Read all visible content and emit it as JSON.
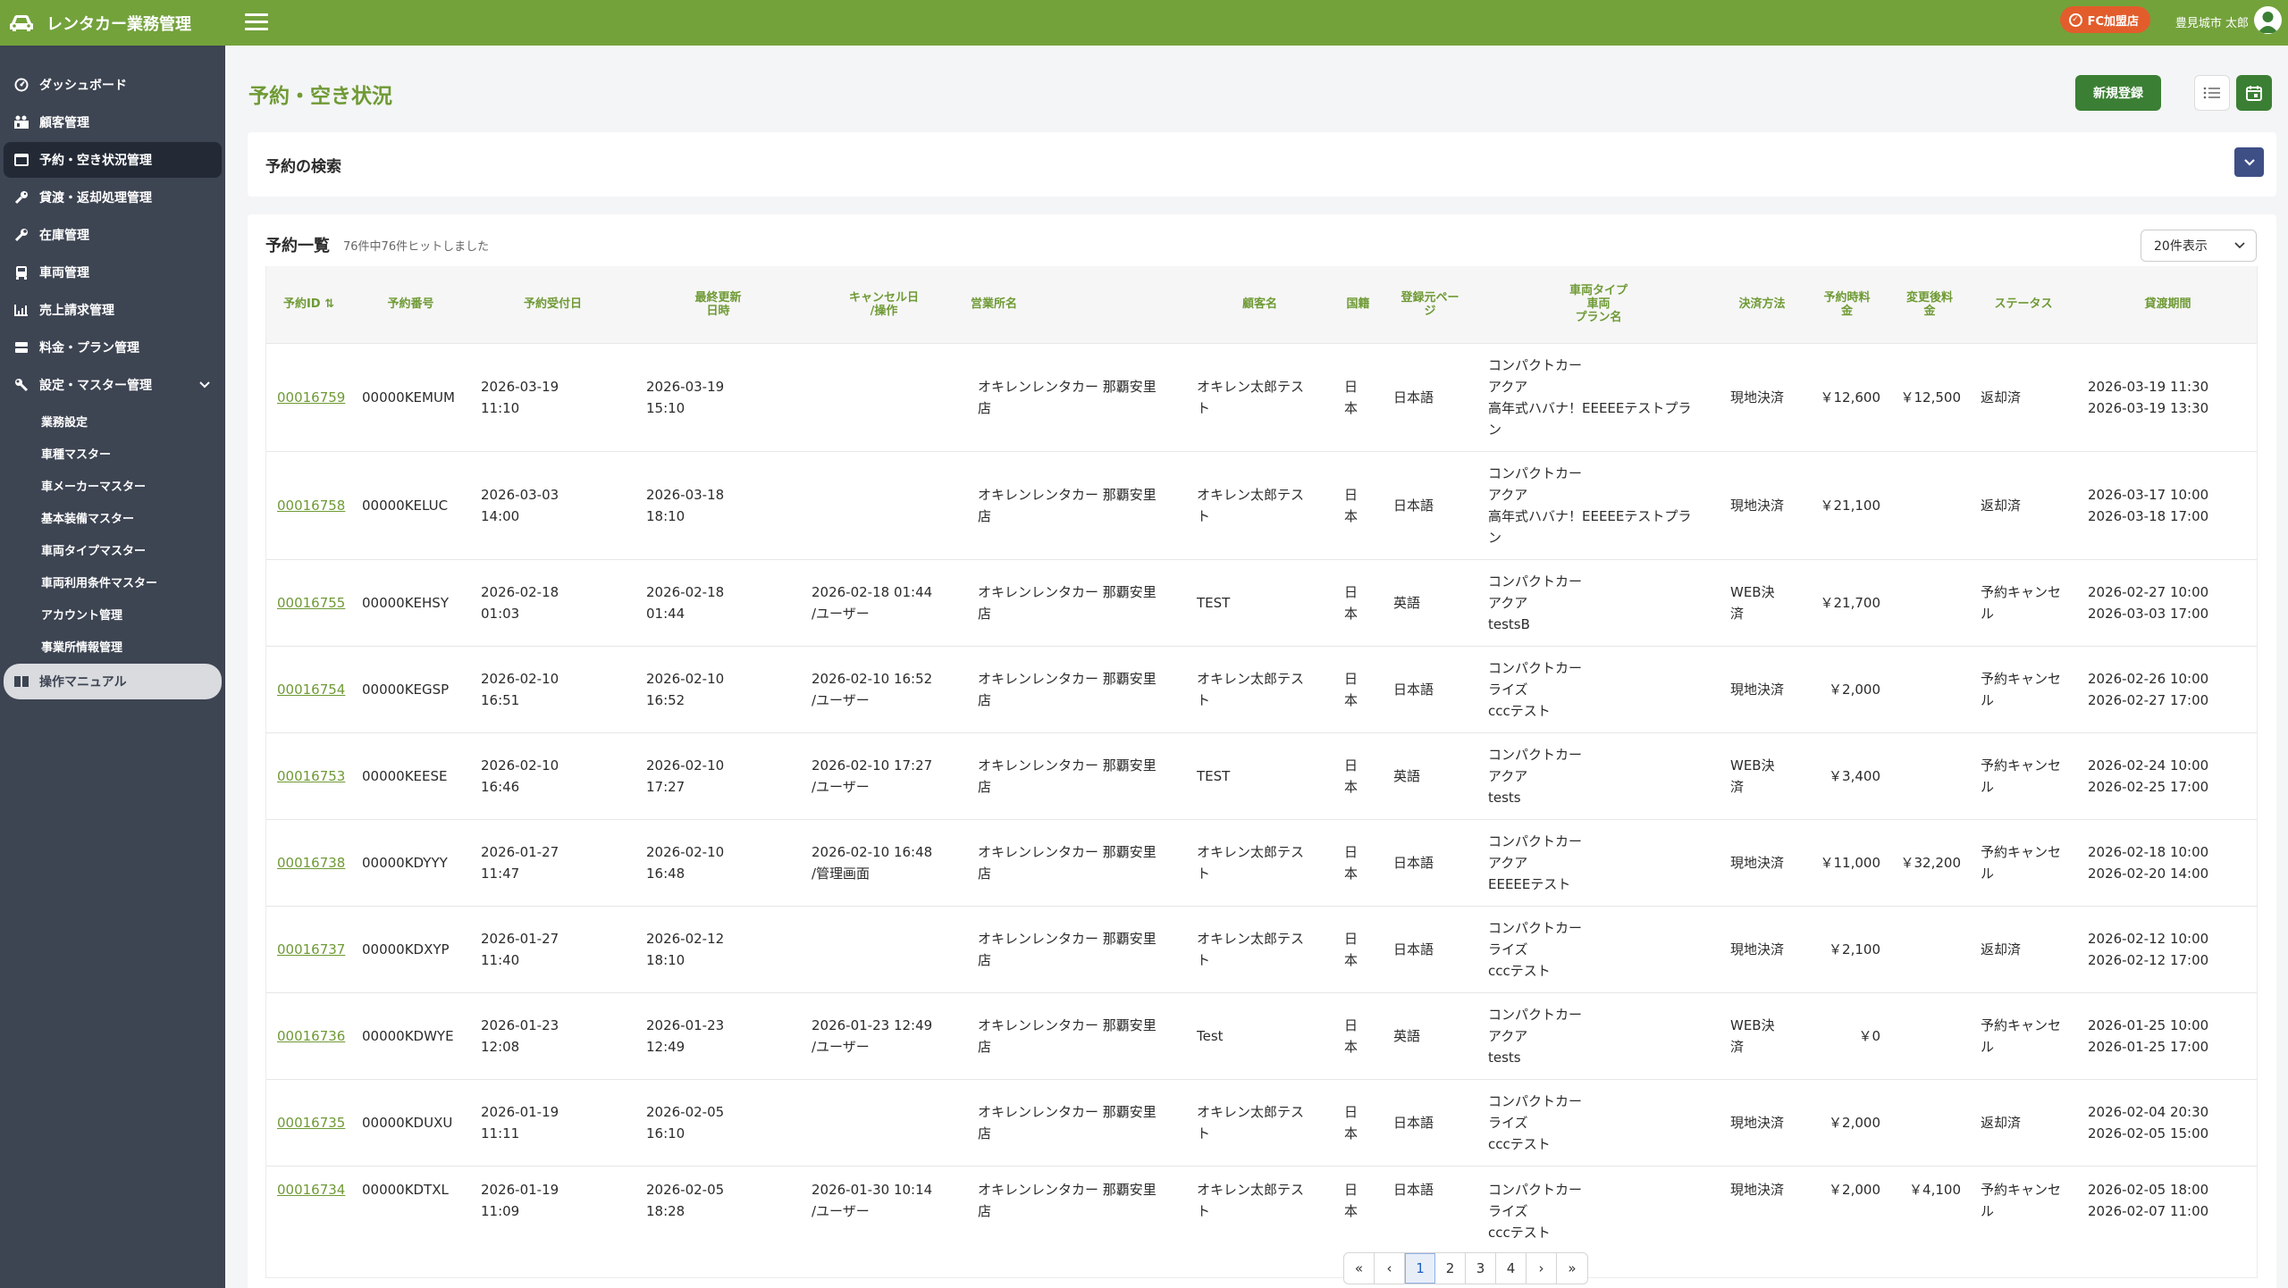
{
  "app": {
    "title": "レンタカー業務管理"
  },
  "topbar": {
    "fc_badge": "FC加盟店",
    "user_name": "豊見城市 太郎"
  },
  "sidebar": {
    "items": [
      {
        "label": "ダッシュボード",
        "icon": "dashboard-icon"
      },
      {
        "label": "顧客管理",
        "icon": "customers-icon"
      },
      {
        "label": "予約・空き状況管理",
        "icon": "calendar-icon"
      },
      {
        "label": "貸渡・返却処理管理",
        "icon": "key-icon"
      },
      {
        "label": "在庫管理",
        "icon": "wrench-icon"
      },
      {
        "label": "車両管理",
        "icon": "car-icon"
      },
      {
        "label": "売上請求管理",
        "icon": "sales-chart-icon"
      },
      {
        "label": "料金・プラン管理",
        "icon": "price-icon"
      },
      {
        "label": "設定・マスター管理",
        "icon": "settings-icon"
      }
    ],
    "sub_items": [
      "業務設定",
      "車種マスター",
      "車メーカーマスター",
      "基本装備マスター",
      "車両タイプマスター",
      "車両利用条件マスター",
      "アカウント管理",
      "事業所情報管理"
    ],
    "manual": {
      "label": "操作マニュアル",
      "icon": "book-icon"
    }
  },
  "page": {
    "title": "予約・空き状況",
    "new_button": "新規登録"
  },
  "search": {
    "title": "予約の検索"
  },
  "list": {
    "title": "予約一覧",
    "hit_count": "76件中76件ヒットしました",
    "page_size": "20件表示"
  },
  "table": {
    "headers": {
      "id": "予約ID ⇅",
      "num": "予約番号",
      "received": "予約受付日",
      "updated": "最終更新\n日時",
      "cancel": "キャンセル日\n/操作",
      "office": "営業所名",
      "customer": "顧客名",
      "nation": "国籍",
      "source": "登録元ペー\nジ",
      "vehicle": "車両タイプ\n車両\nプラン名",
      "payment": "決済方法",
      "fee": "予約時料\n金",
      "fee_changed": "変更後料\n金",
      "status": "ステータス",
      "period": "貸渡期間"
    },
    "rows": [
      {
        "id": "00016759",
        "num": "00000KEMUM",
        "received": "2026-03-19\n11:10",
        "updated": "2026-03-19\n15:10",
        "cancel": "",
        "office": "オキレンレンタカー 那覇安里\n店",
        "customer": "オキレン太郎テス\nト",
        "nation": "日\n本",
        "source": "日本語",
        "vehicle": "コンパクトカー\nアクア\n高年式ハバナ！EEEEEテストプラ\nン",
        "payment": "現地決済",
        "fee": "￥12,600",
        "fee_changed": "￥12,500",
        "status": "返却済",
        "period": "2026-03-19 11:30\n2026-03-19 13:30"
      },
      {
        "id": "00016758",
        "num": "00000KELUC",
        "received": "2026-03-03\n14:00",
        "updated": "2026-03-18\n18:10",
        "cancel": "",
        "office": "オキレンレンタカー 那覇安里\n店",
        "customer": "オキレン太郎テス\nト",
        "nation": "日\n本",
        "source": "日本語",
        "vehicle": "コンパクトカー\nアクア\n高年式ハバナ！EEEEEテストプラ\nン",
        "payment": "現地決済",
        "fee": "￥21,100",
        "fee_changed": "",
        "status": "返却済",
        "period": "2026-03-17 10:00\n2026-03-18 17:00"
      },
      {
        "id": "00016755",
        "num": "00000KEHSY",
        "received": "2026-02-18\n01:03",
        "updated": "2026-02-18\n01:44",
        "cancel": "2026-02-18 01:44\n/ユーザー",
        "office": "オキレンレンタカー 那覇安里\n店",
        "customer": "TEST",
        "nation": "日\n本",
        "source": "英語",
        "vehicle": "コンパクトカー\nアクア\ntestsB",
        "payment": "WEB決\n済",
        "fee": "￥21,700",
        "fee_changed": "",
        "status": "予約キャンセ\nル",
        "period": "2026-02-27 10:00\n2026-03-03 17:00"
      },
      {
        "id": "00016754",
        "num": "00000KEGSP",
        "received": "2026-02-10\n16:51",
        "updated": "2026-02-10\n16:52",
        "cancel": "2026-02-10 16:52\n/ユーザー",
        "office": "オキレンレンタカー 那覇安里\n店",
        "customer": "オキレン太郎テス\nト",
        "nation": "日\n本",
        "source": "日本語",
        "vehicle": "コンパクトカー\nライズ\ncccテスト",
        "payment": "現地決済",
        "fee": "￥2,000",
        "fee_changed": "",
        "status": "予約キャンセ\nル",
        "period": "2026-02-26 10:00\n2026-02-27 17:00"
      },
      {
        "id": "00016753",
        "num": "00000KEESE",
        "received": "2026-02-10\n16:46",
        "updated": "2026-02-10\n17:27",
        "cancel": "2026-02-10 17:27\n/ユーザー",
        "office": "オキレンレンタカー 那覇安里\n店",
        "customer": "TEST",
        "nation": "日\n本",
        "source": "英語",
        "vehicle": "コンパクトカー\nアクア\ntests",
        "payment": "WEB決\n済",
        "fee": "￥3,400",
        "fee_changed": "",
        "status": "予約キャンセ\nル",
        "period": "2026-02-24 10:00\n2026-02-25 17:00"
      },
      {
        "id": "00016738",
        "num": "00000KDYYY",
        "received": "2026-01-27\n11:47",
        "updated": "2026-02-10\n16:48",
        "cancel": "2026-02-10 16:48\n/管理画面",
        "office": "オキレンレンタカー 那覇安里\n店",
        "customer": "オキレン太郎テス\nト",
        "nation": "日\n本",
        "source": "日本語",
        "vehicle": "コンパクトカー\nアクア\nEEEEEテスト",
        "payment": "現地決済",
        "fee": "￥11,000",
        "fee_changed": "￥32,200",
        "status": "予約キャンセ\nル",
        "period": "2026-02-18 10:00\n2026-02-20 14:00"
      },
      {
        "id": "00016737",
        "num": "00000KDXYP",
        "received": "2026-01-27\n11:40",
        "updated": "2026-02-12\n18:10",
        "cancel": "",
        "office": "オキレンレンタカー 那覇安里\n店",
        "customer": "オキレン太郎テス\nト",
        "nation": "日\n本",
        "source": "日本語",
        "vehicle": "コンパクトカー\nライズ\ncccテスト",
        "payment": "現地決済",
        "fee": "￥2,100",
        "fee_changed": "",
        "status": "返却済",
        "period": "2026-02-12 10:00\n2026-02-12 17:00"
      },
      {
        "id": "00016736",
        "num": "00000KDWYE",
        "received": "2026-01-23\n12:08",
        "updated": "2026-01-23\n12:49",
        "cancel": "2026-01-23 12:49\n/ユーザー",
        "office": "オキレンレンタカー 那覇安里\n店",
        "customer": "Test",
        "nation": "日\n本",
        "source": "英語",
        "vehicle": "コンパクトカー\nアクア\ntests",
        "payment": "WEB決\n済",
        "fee": "￥0",
        "fee_changed": "",
        "status": "予約キャンセ\nル",
        "period": "2026-01-25 10:00\n2026-01-25 17:00"
      },
      {
        "id": "00016735",
        "num": "00000KDUXU",
        "received": "2026-01-19\n11:11",
        "updated": "2026-02-05\n16:10",
        "cancel": "",
        "office": "オキレンレンタカー 那覇安里\n店",
        "customer": "オキレン太郎テス\nト",
        "nation": "日\n本",
        "source": "日本語",
        "vehicle": "コンパクトカー\nライズ\ncccテスト",
        "payment": "現地決済",
        "fee": "￥2,000",
        "fee_changed": "",
        "status": "返却済",
        "period": "2026-02-04 20:30\n2026-02-05 15:00"
      },
      {
        "id": "00016734",
        "num": "00000KDTXL",
        "received": "2026-01-19\n11:09",
        "updated": "2026-02-05\n18:28",
        "cancel": "2026-01-30 10:14\n/ユーザー",
        "office": "オキレンレンタカー 那覇安里\n店",
        "customer": "オキレン太郎テス\nト",
        "nation": "日\n本",
        "source": "日本語",
        "vehicle": "コンパクトカー\nライズ\ncccテスト",
        "payment": "現地決済",
        "fee": "￥2,000",
        "fee_changed": "￥4,100",
        "status": "予約キャンセ\nル",
        "period": "2026-02-05 18:00\n2026-02-07 11:00"
      }
    ]
  },
  "pagination": {
    "first": "«",
    "prev": "‹",
    "pages": [
      "1",
      "2",
      "3",
      "4"
    ],
    "current": "1",
    "next": "›",
    "last": "»"
  },
  "colors": {
    "brand": "#73a23b",
    "sidebar": "#3d4452",
    "accent_dark": "#3b7f34",
    "link": "#6f9a35",
    "fc_badge": "#e25d2b"
  }
}
